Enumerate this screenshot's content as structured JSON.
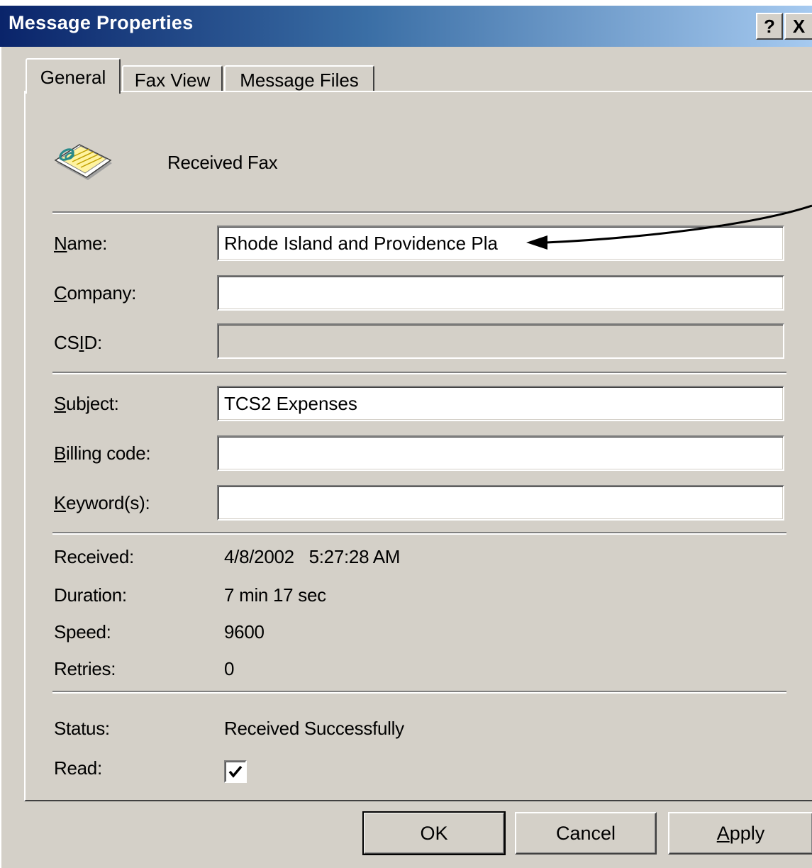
{
  "window": {
    "title": "Message Properties",
    "help_glyph": "?",
    "close_glyph": "X"
  },
  "tabs": [
    {
      "label": "General",
      "active": true
    },
    {
      "label": "Fax View",
      "active": false
    },
    {
      "label": "Message Files",
      "active": false
    }
  ],
  "header": {
    "icon": "fax-document-icon",
    "type_label": "Received Fax"
  },
  "fields": {
    "name": {
      "label_pre": "",
      "label_key": "N",
      "label_post": "ame:",
      "value": "Rhode Island and Providence Pla"
    },
    "company": {
      "label_pre": "",
      "label_key": "C",
      "label_post": "ompany:",
      "value": ""
    },
    "csid": {
      "label_pre": "CS",
      "label_key": "I",
      "label_post": "D:",
      "value": "",
      "disabled": true
    },
    "subject": {
      "label_pre": "",
      "label_key": "S",
      "label_post": "ubject:",
      "value": "TCS2 Expenses"
    },
    "billing": {
      "label_pre": "",
      "label_key": "B",
      "label_post": "illing code:",
      "value": ""
    },
    "keywords": {
      "label_pre": "",
      "label_key": "K",
      "label_post": "eyword(s):",
      "value": ""
    }
  },
  "info": {
    "received_label": "Received:",
    "received_value": "4/8/2002   5:27:28 AM",
    "duration_label": "Duration:",
    "duration_value": "7 min 17 sec",
    "speed_label": "Speed:",
    "speed_value": "9600",
    "retries_label": "Retries:",
    "retries_value": "0",
    "status_label": "Status:",
    "status_value": "Received Successfully",
    "read_label": "Read:",
    "read_checked": true
  },
  "buttons": {
    "ok": "OK",
    "cancel": "Cancel",
    "apply_key": "A",
    "apply_rest": "pply"
  },
  "colors": {
    "dialog_bg": "#d4d0c8",
    "title_start": "#0a246a",
    "title_end": "#a6caf0"
  }
}
